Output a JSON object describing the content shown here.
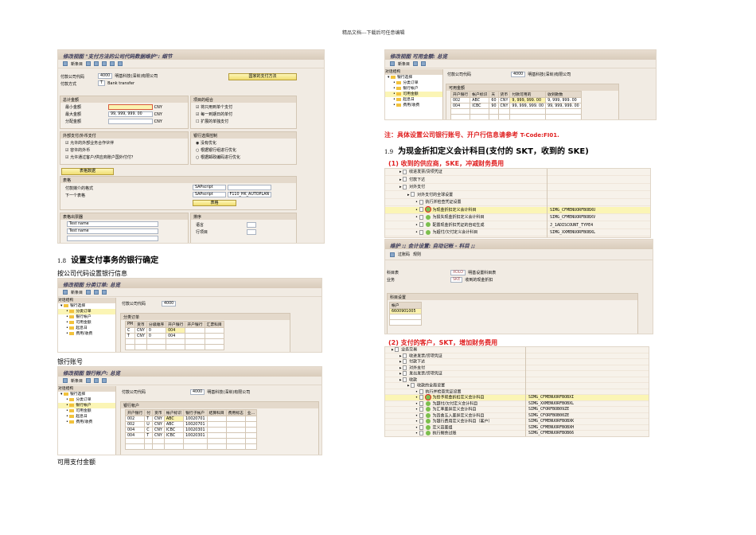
{
  "header": "精品文档---下载后可任意编辑",
  "s1": {
    "title": "修改视图 \"支付方法的公司代码数据维护\": 细节",
    "toolbar": "新条目",
    "cc_label": "付款公司代码",
    "cc": "4000",
    "company": "明基科技(深圳)有限公司",
    "pm_label": "付款方式",
    "pm": "T",
    "pm_desc": "Bank transfer",
    "btn_methods": "国家的支付方法",
    "amt": {
      "title": "总计金额",
      "min": "最小金额",
      "max": "最大金额",
      "max_val": "99, 999, 999. 00",
      "dist": "分配金额",
      "cur": "CNY"
    },
    "grp_items": {
      "title": "项目的组合",
      "items": [
        "将只用到单个支付",
        "每一到期日的单付",
        "扩展的单独支付"
      ],
      "checked": [
        true,
        true,
        false
      ]
    },
    "foreign": {
      "title": "外部支付/外币支付",
      "items": [
        "允许的外部业务合作伙伴",
        "容许的外币",
        "允许通过客户/供应商账户国外付付？"
      ]
    },
    "bank_sel": {
      "title": "银行选择控制",
      "items": [
        "没有优化",
        "根据银行组进行优化",
        "根据邮政编码进行优化"
      ]
    },
    "btn_form_data": "表格数据",
    "forms": {
      "title": "表格",
      "f1": "付款媒介的格式",
      "f2": "下一个表格",
      "script": "SAPscript",
      "f2_val": "F110_HK_AUTOPLAN",
      "btn": "表格"
    },
    "sender": {
      "title": "表格出票器",
      "names": [
        "Test name",
        "Test name"
      ]
    },
    "sort": {
      "title": "排序",
      "s1": "语言",
      "s2": "行项目"
    }
  },
  "sec18": {
    "num": "1.8",
    "title": "设置支付事务的银行确定",
    "sub": "按公司代码设置银行信息"
  },
  "s2": {
    "title": "修改视图 分类订单: 总览",
    "toolbar": "新条目",
    "tree_title": "对话结构",
    "tree": [
      "银行选择",
      "分类订单",
      "银行帐户",
      "可用金额",
      "起息日",
      "费用/收费"
    ],
    "cc_label": "付款公司代码",
    "cc": "4000",
    "grid_title": "分类订单",
    "cols": [
      "PM",
      "货币",
      "分级顺序",
      "开户银行",
      "开户银行",
      "汇票科目"
    ],
    "rows": [
      [
        "C",
        "CNY",
        "0",
        "004",
        "",
        " "
      ],
      [
        "T",
        "CNY",
        "0",
        "004",
        "",
        ""
      ]
    ]
  },
  "bank_acct_label": "银行账号",
  "s3": {
    "title": "修改视图 银行帐户: 总览",
    "toolbar": "新条目",
    "tree_title": "对话结构",
    "tree": [
      "银行选择",
      "分类订单",
      "银行帐户",
      "可用金额",
      "起息日",
      "费用/收费"
    ],
    "cc_label": "付款公司代码",
    "cc": "4000",
    "company": "明基科技(深圳)有限公司",
    "grid_title": "银行帐户",
    "cols": [
      "开户银行",
      "付",
      "货币",
      "帐户标识",
      "银行子帐户",
      "结算科目",
      "费用标志",
      "业..."
    ],
    "rows": [
      [
        "002",
        "T",
        "CNY",
        "ABC",
        "10020701",
        "",
        "",
        ""
      ],
      [
        "002",
        "U",
        "CNY",
        "ABC",
        "10020701",
        "",
        "",
        ""
      ],
      [
        "004",
        "C",
        "CNY",
        "ICBC",
        "10020301",
        "",
        "",
        ""
      ],
      [
        "004",
        "T",
        "CNY",
        "ICBC",
        "10020301",
        "",
        "",
        ""
      ]
    ]
  },
  "avail_label": "可用支付金额",
  "s4": {
    "title": "修改视图 可用金额: 总览",
    "toolbar": "新条目",
    "tree_title": "对话结构",
    "tree": [
      "银行选择",
      "分类订单",
      "银行帐户",
      "可用金额",
      "起息日",
      "费用/收费"
    ],
    "cc_label": "付款公司代码",
    "cc": "4000",
    "company": "明基科技(深圳)有限公司",
    "grid_title": "可用金额",
    "cols": [
      "开户银行",
      "帐户标识",
      "天",
      "货币",
      "付款可用的",
      "收到款数"
    ],
    "rows": [
      [
        "002",
        "ABC",
        "60",
        "CNY",
        "9, 999, 999. 00",
        "9, 999, 999. 00"
      ],
      [
        "004",
        "ICBC",
        "90",
        "CNY",
        "99, 999, 999. 00",
        "99, 999, 999. 00"
      ]
    ]
  },
  "note": {
    "prefix": "注：具体设置公司银行账号、开户行信息请参考 ",
    "code": "T-Code:FI01."
  },
  "sec19": {
    "num": "1.9",
    "title": "为现金折扣定义会计科目(支付的 SKT，收到的 SKE)"
  },
  "p1": {
    "label": "(1) 收到的供应商，SKE，冲减财务费用",
    "tree": [
      {
        "t": "收进发票/贷项凭证",
        "d": 1,
        "c": ""
      },
      {
        "t": "付款下达",
        "d": 1,
        "c": ""
      },
      {
        "t": "对外支付",
        "d": 1,
        "c": ""
      },
      {
        "t": "对外支付的全球设置",
        "d": 2,
        "c": ""
      },
      {
        "t": "执行并检查凭证设置",
        "d": 3,
        "c": ""
      },
      {
        "t": "为现金折扣定义会计科目",
        "d": 3,
        "c": "SIMG_CFMENUORFBOBXU",
        "hl": true
      },
      {
        "t": "为损失现金折扣定义会计科目",
        "d": 3,
        "c": "SIMG_CFMENUORFBOBXV"
      },
      {
        "t": "配置现金折扣凭证的自动生成",
        "d": 3,
        "c": "J_1ADISCOUNT_TYPE4"
      },
      {
        "t": "为超付/欠付定义会计科目",
        "d": 3,
        "c": "SIMG_XXMENUORFBOBXL"
      }
    ]
  },
  "s5": {
    "title": "维护 :; 会计设置: 自动记帐 - 科目 ;;",
    "tb1": "过账码",
    "tb2": "规则",
    "coa_label": "科目表",
    "coa": "XOLO",
    "coa_desc": "明基设置科目表",
    "tx_label": "业务",
    "tx": "SKE",
    "tx_desc": "收到的现金折扣",
    "grid_title": "科目设置",
    "col": "帐户",
    "acct": "6600901005"
  },
  "p2": {
    "label": "(2) 支付的客户，SKT，增加财务费用",
    "tree": [
      {
        "t": "业务交易",
        "d": 0,
        "c": ""
      },
      {
        "t": "收进发票/贷项凭证",
        "d": 1,
        "c": ""
      },
      {
        "t": "付款下达",
        "d": 1,
        "c": ""
      },
      {
        "t": "对外支付",
        "d": 1,
        "c": ""
      },
      {
        "t": "发出发票/贷项凭证",
        "d": 1,
        "c": ""
      },
      {
        "t": "收款",
        "d": 1,
        "c": ""
      },
      {
        "t": "收款的全局设置",
        "d": 2,
        "c": ""
      },
      {
        "t": "执行并检查凭证设置",
        "d": 3,
        "c": ""
      },
      {
        "t": "为授予现金折扣定义会计科目",
        "d": 3,
        "c": "SIMG_CFMENUORFBOBXI",
        "hl": true
      },
      {
        "t": "为超付/欠付定义会计科目",
        "d": 3,
        "c": "SIMG_XXMENUORFBOBXL"
      },
      {
        "t": "为汇率差异定义会计科目",
        "d": 3,
        "c": "SIMG_CFORFBOB09ZE"
      },
      {
        "t": "为四舍五入差异定义会计科目",
        "d": 3,
        "c": "SIMG_CFORFBOB00ZE"
      },
      {
        "t": "为银行费用定义会计科目（客户）",
        "d": 3,
        "c": "SIMG_CFMENUORFBOBXK"
      },
      {
        "t": "定义容差组",
        "d": 3,
        "c": "SIMG_CFMENUORFBOBXH"
      },
      {
        "t": "执行剩余过账",
        "d": 3,
        "c": "SIMG_CFMENUORFBOB66"
      }
    ]
  }
}
